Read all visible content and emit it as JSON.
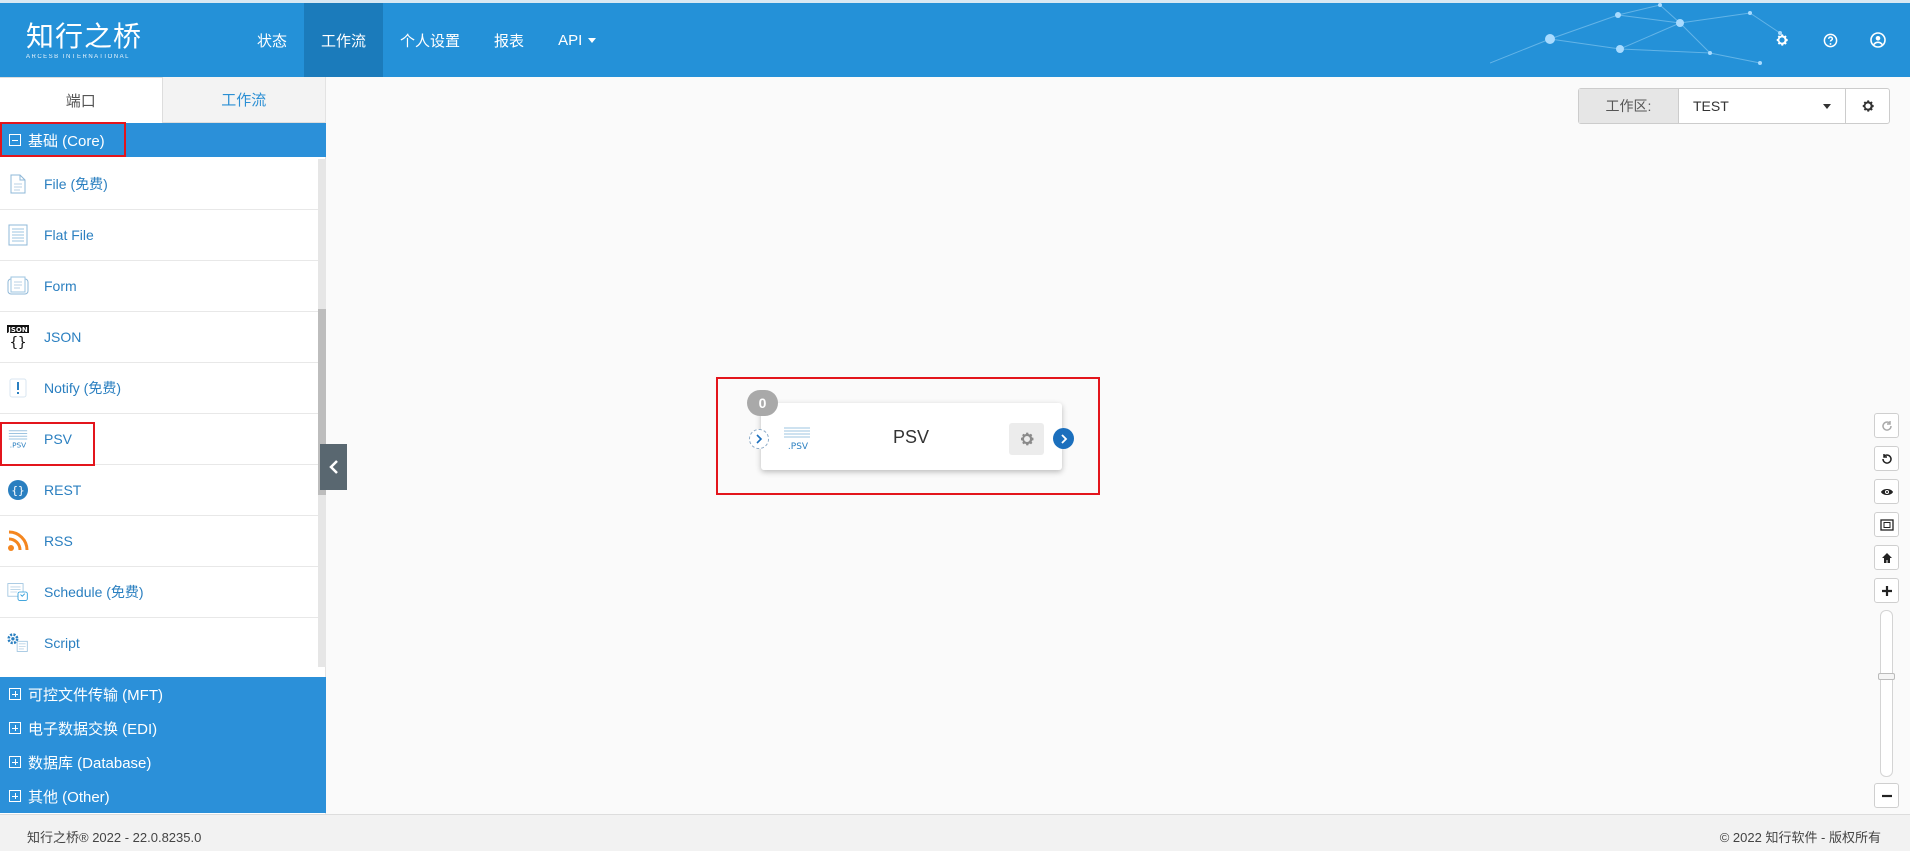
{
  "header": {
    "logo_text": "知行之桥",
    "logo_sub": "ARCESB INTERNATIONAL",
    "nav": [
      {
        "label": "状态"
      },
      {
        "label": "工作流"
      },
      {
        "label": "个人设置"
      },
      {
        "label": "报表"
      },
      {
        "label": "API"
      }
    ],
    "icons": [
      "gear-icon",
      "help-icon",
      "user-icon"
    ]
  },
  "sidebar": {
    "tabs": [
      {
        "label": "端口"
      },
      {
        "label": "工作流"
      }
    ],
    "core_category": "基础 (Core)",
    "items": [
      {
        "label": "File (免费)",
        "icon": "file-icon"
      },
      {
        "label": "Flat File",
        "icon": "flat-file-icon"
      },
      {
        "label": "Form",
        "icon": "form-icon"
      },
      {
        "label": "JSON",
        "icon": "json-icon"
      },
      {
        "label": "Notify (免费)",
        "icon": "notify-icon"
      },
      {
        "label": "PSV",
        "icon": "psv-icon"
      },
      {
        "label": "REST",
        "icon": "rest-icon"
      },
      {
        "label": "RSS",
        "icon": "rss-icon"
      },
      {
        "label": "Schedule (免费)",
        "icon": "schedule-icon"
      },
      {
        "label": "Script",
        "icon": "script-icon"
      }
    ],
    "other_categories": [
      {
        "label": "可控文件传输 (MFT)"
      },
      {
        "label": "电子数据交换 (EDI)"
      },
      {
        "label": "数据库 (Database)"
      },
      {
        "label": "其他 (Other)"
      }
    ]
  },
  "workspace": {
    "label": "工作区:",
    "value": "TEST"
  },
  "node": {
    "badge": "0",
    "title": "PSV",
    "icon_text": ".PSV"
  },
  "tools": [
    "refresh-icon",
    "undo-icon",
    "eye-icon",
    "fit-screen-icon",
    "home-icon",
    "zoom-in-icon",
    "zoom-out-icon"
  ],
  "footer": {
    "left": "知行之桥® 2022 - 22.0.8235.0",
    "right": "© 2022 知行软件 - 版权所有"
  },
  "colors": {
    "primary": "#2491d8",
    "highlight": "#e3151c",
    "link": "#2a7fc0"
  }
}
